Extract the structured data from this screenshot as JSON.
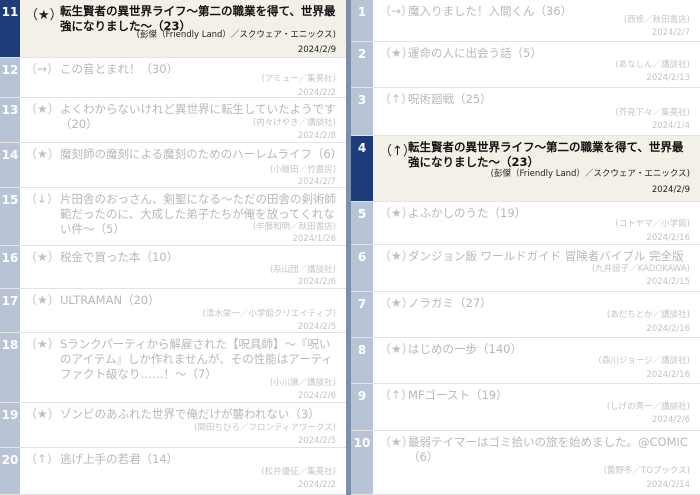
{
  "left_list": [
    {
      "rank": "11",
      "mark": "（★）",
      "title": "転生賢者の異世界ライフ〜第二の職業を得て、世界最強になりました〜（23）",
      "author": "(彭傑（Friendly Land）／スクウェア・エニックス)",
      "date": "2024/2/9",
      "selected": true
    },
    {
      "rank": "12",
      "mark": "（→）",
      "title": "この音とまれ！（30）",
      "author": "(アミュー／集英社)",
      "date": "2024/2/2"
    },
    {
      "rank": "13",
      "mark": "（★）",
      "title": "よくわからないけれど異世界に転生していたようです（20）",
      "author": "(内々けやき／講談社)",
      "date": "2024/2/8"
    },
    {
      "rank": "14",
      "mark": "（★）",
      "title": "魔刻師の魔刻による魔刻のためのハーレムライフ（6）",
      "author": "(小飯田／竹書房)",
      "date": "2024/2/7"
    },
    {
      "rank": "15",
      "mark": "（↓）",
      "title": "片田舎のおっさん、剣聖になる〜ただの田舎の剣術師範だったのに、大成した弟子たちが俺を放ってくれない件〜（5）",
      "author": "(乍藤和明／秋田書店)",
      "date": "2024/1/26"
    },
    {
      "rank": "16",
      "mark": "（★）",
      "title": "税金で買った本（10）",
      "author": "(系山団／講談社)",
      "date": "2024/2/6"
    },
    {
      "rank": "17",
      "mark": "（★）",
      "title": "ULTRAMAN（20）",
      "author": "(清水栄一／小学館クリエイティブ)",
      "date": "2024/2/5"
    },
    {
      "rank": "18",
      "mark": "（★）",
      "title": "Sランクパーティから解雇された【呪具師】〜『呪いのアイテム』しか作れませんが、その性能はアーティファクト級なり……！〜（7）",
      "author": "(小川譲／講談社)",
      "date": "2024/2/6"
    },
    {
      "rank": "19",
      "mark": "（★）",
      "title": "ゾンビのあふれた世界で俺だけが襲われない（3）",
      "author": "(関田ちひろ／フロンティアワークス)",
      "date": "2024/2/5"
    },
    {
      "rank": "20",
      "mark": "（↑）",
      "title": "逃げ上手の若君（14）",
      "author": "(松井優征／集英社)",
      "date": "2024/2/2"
    }
  ],
  "right_list": [
    {
      "rank": "1",
      "mark": "（→）",
      "title": "魔入りました！入間くん（36）",
      "author": "(西修／秋田書店)",
      "date": "2024/2/7"
    },
    {
      "rank": "2",
      "mark": "（★）",
      "title": "運命の人に出会う話（5）",
      "author": "(あなしん／講談社)",
      "date": "2024/2/13"
    },
    {
      "rank": "3",
      "mark": "（↑）",
      "title": "呪術廻戦（25）",
      "author": "(芥見下々／集英社)",
      "date": "2024/1/4"
    },
    {
      "rank": "4",
      "mark": "（↑）",
      "title": "転生賢者の異世界ライフ〜第二の職業を得て、世界最強になりました〜（23）",
      "author": "(彭傑（Friendly Land）／スクウェア・エニックス)",
      "date": "2024/2/9",
      "selected": true
    },
    {
      "rank": "5",
      "mark": "（★）",
      "title": "よふかしのうた（19）",
      "author": "(コトヤマ／小学館)",
      "date": "2024/2/16"
    },
    {
      "rank": "6",
      "mark": "（★）",
      "title": "ダンジョン飯 ワールドガイド 冒険者バイブル 完全版",
      "author": "(九井諒子／KADOKAWA)",
      "date": "2024/2/15"
    },
    {
      "rank": "7",
      "mark": "（★）",
      "title": "ノラガミ（27）",
      "author": "(あだちとか／講談社)",
      "date": "2024/2/16"
    },
    {
      "rank": "8",
      "mark": "（★）",
      "title": "はじめの一歩（140）",
      "author": "(森川ジョージ／講談社)",
      "date": "2024/2/16"
    },
    {
      "rank": "9",
      "mark": "（↑）",
      "title": "MFゴースト（19）",
      "author": "(しげの秀一／講談社)",
      "date": "2024/2/6"
    },
    {
      "rank": "10",
      "mark": "（★）",
      "title": "最弱テイマーはゴミ拾いの旅を始めました。@COMIC（6）",
      "author": "(薗野冬／TOブックス)",
      "date": "2024/2/14"
    }
  ]
}
